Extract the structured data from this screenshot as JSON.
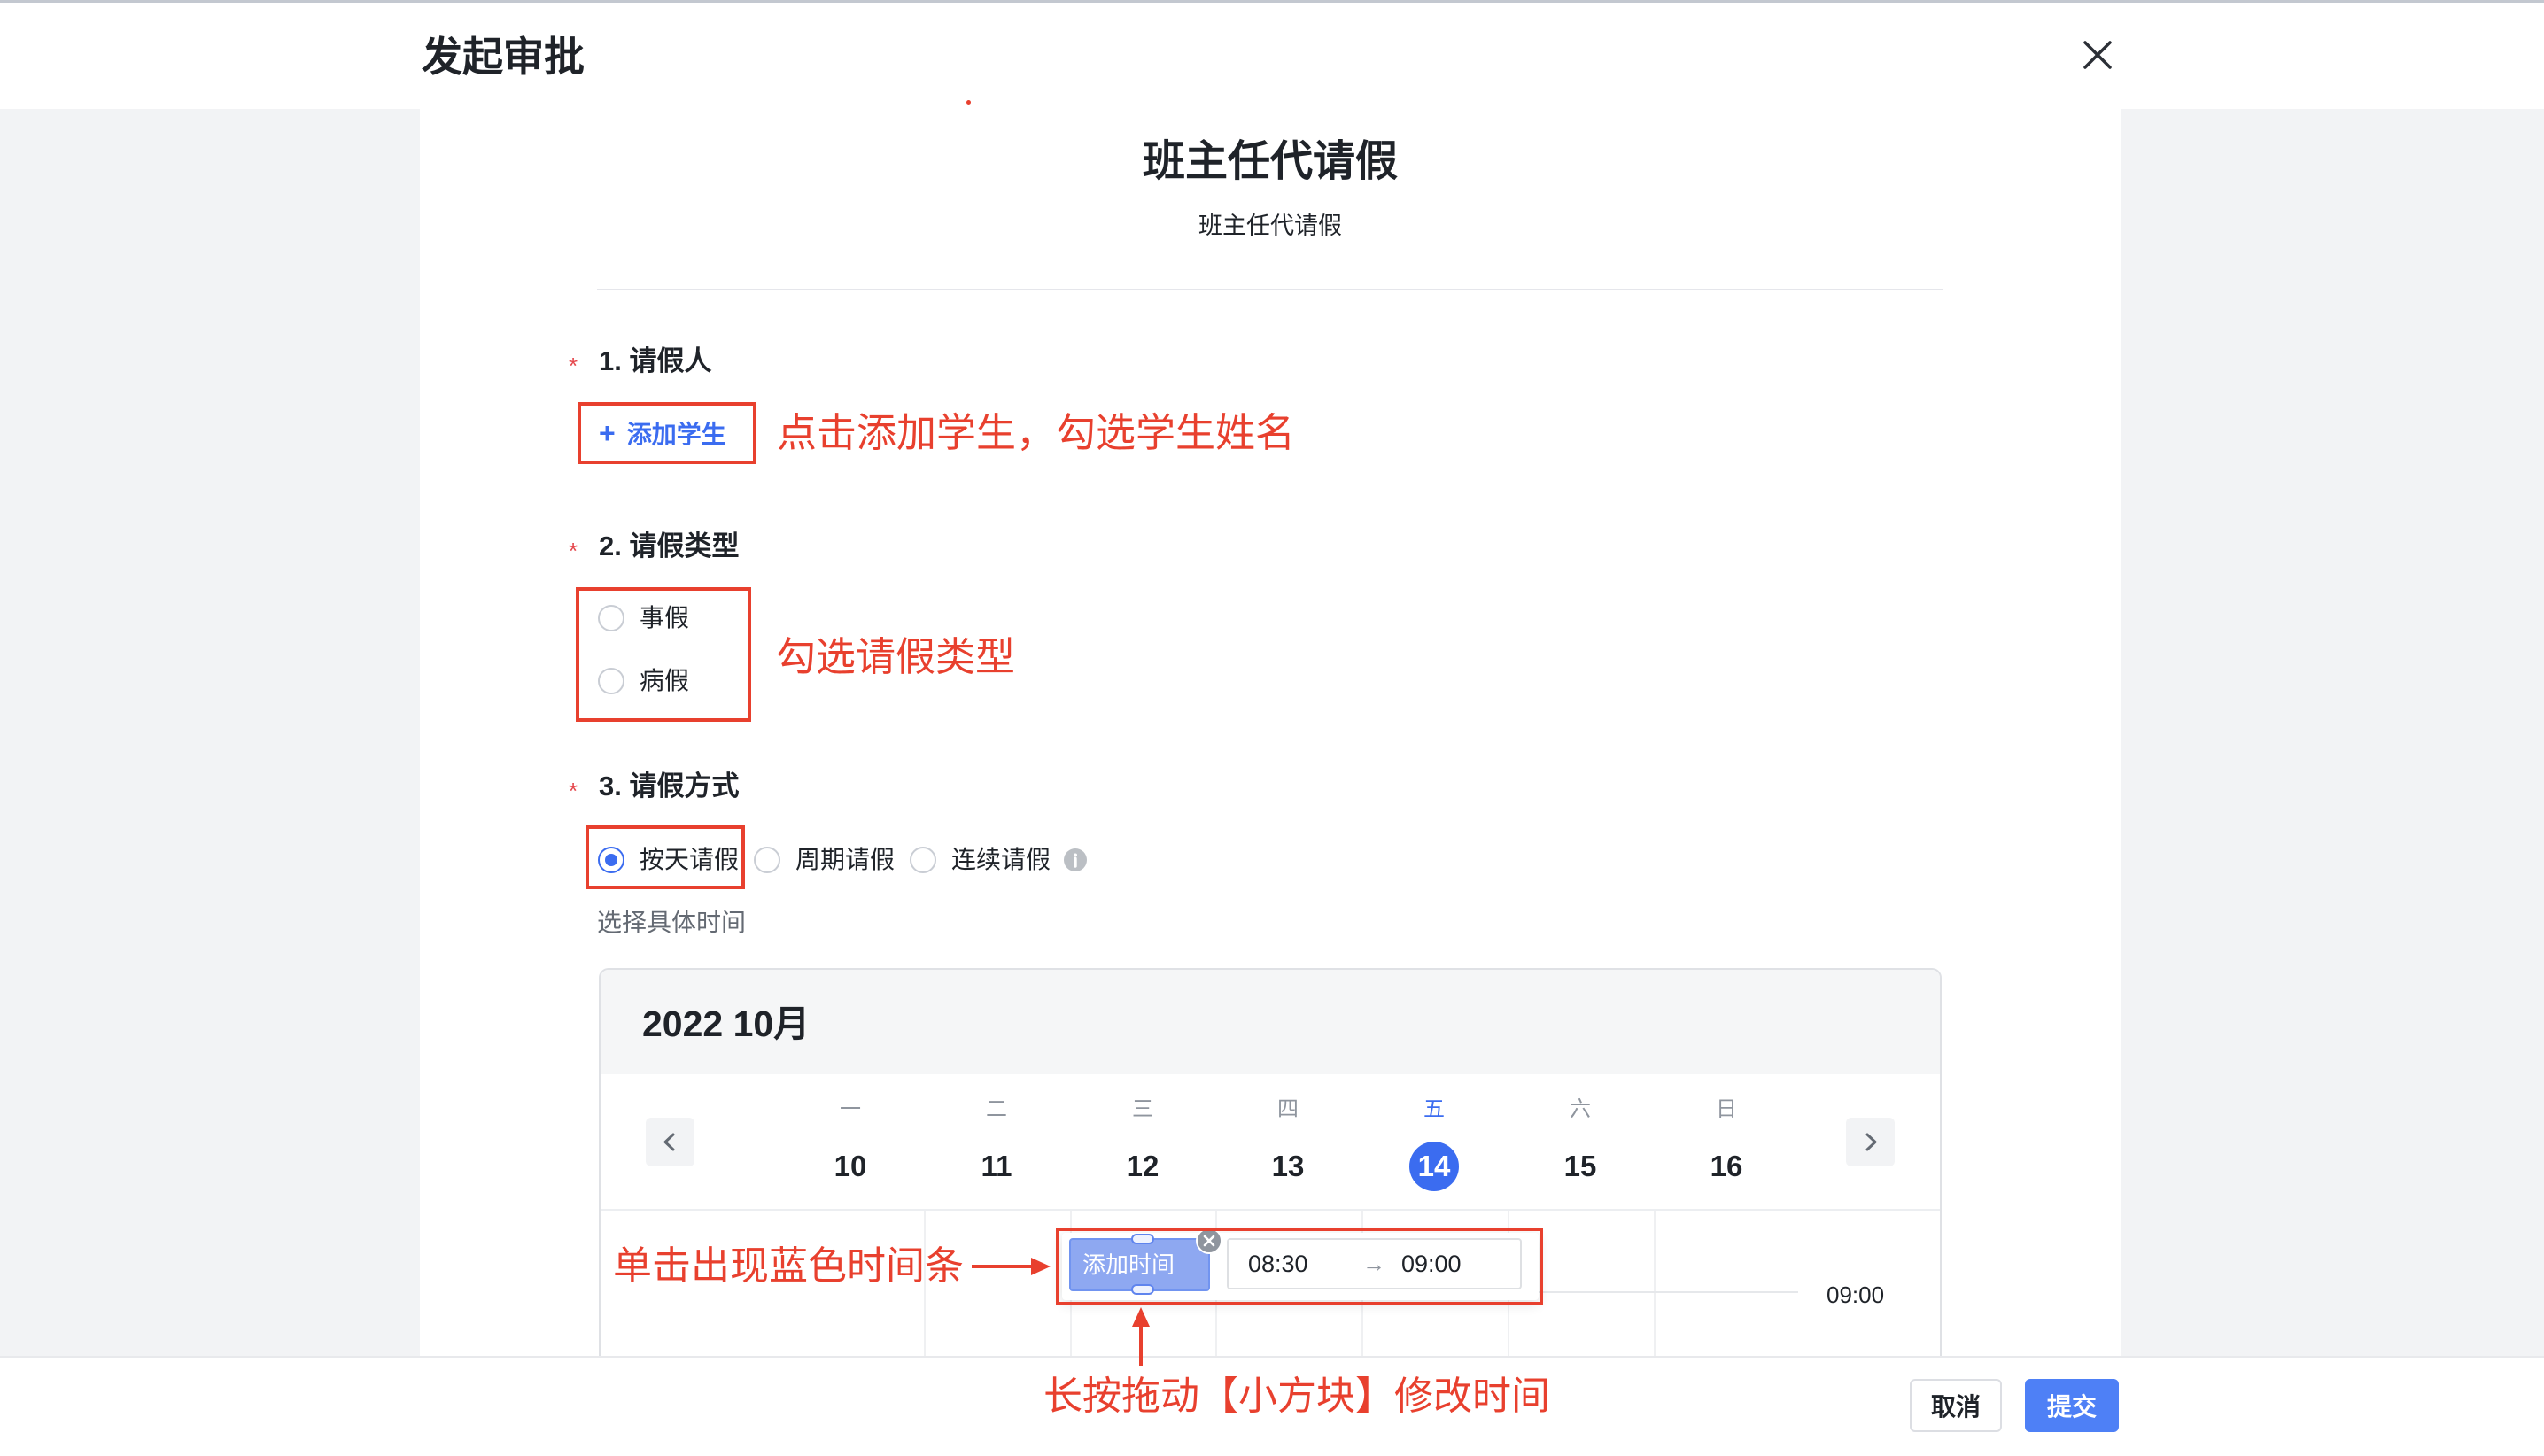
{
  "header": {
    "title": "发起审批"
  },
  "form": {
    "title": "班主任代请假",
    "subtitle": "班主任代请假",
    "required_mark": "*",
    "student": {
      "label": "1. 请假人",
      "add_glyph": "+",
      "add_label": "添加学生"
    },
    "leave_type": {
      "label": "2. 请假类型",
      "options": [
        {
          "label": "事假",
          "checked": false
        },
        {
          "label": "病假",
          "checked": false
        }
      ]
    },
    "leave_mode": {
      "label": "3. 请假方式",
      "options": [
        {
          "label": "按天请假",
          "checked": true
        },
        {
          "label": "周期请假",
          "checked": false
        },
        {
          "label": "连续请假",
          "checked": false
        }
      ],
      "time_hint": "选择具体时间"
    }
  },
  "calendar": {
    "month": "2022 10月",
    "days": [
      {
        "weekday": "一",
        "date": "10",
        "selected": false
      },
      {
        "weekday": "二",
        "date": "11",
        "selected": false
      },
      {
        "weekday": "三",
        "date": "12",
        "selected": false
      },
      {
        "weekday": "四",
        "date": "13",
        "selected": false
      },
      {
        "weekday": "五",
        "date": "14",
        "selected": true
      },
      {
        "weekday": "六",
        "date": "15",
        "selected": false
      },
      {
        "weekday": "日",
        "date": "16",
        "selected": false
      }
    ],
    "time_label": "09:00",
    "event": {
      "label": "添加时间",
      "start": "08:30",
      "arrow": "→",
      "end": "09:00"
    }
  },
  "annotations": {
    "add_student": "点击添加学生，勾选学生姓名",
    "leave_type": "勾选请假类型",
    "time_bar": "单击出现蓝色时间条",
    "drag": "长按拖动【小方块】修改时间"
  },
  "footer": {
    "cancel": "取消",
    "submit": "提交"
  },
  "colors": {
    "primary": "#3b6cf0",
    "annotation": "#e8402e",
    "required": "#e5484d",
    "event_bar": "#8ea8f1",
    "submit": "#4e80f6"
  },
  "icons": {
    "close": "close-icon",
    "prev": "chevron-left-icon",
    "next": "chevron-right-icon",
    "info": "info-icon",
    "event_remove": "close-circle-icon"
  }
}
